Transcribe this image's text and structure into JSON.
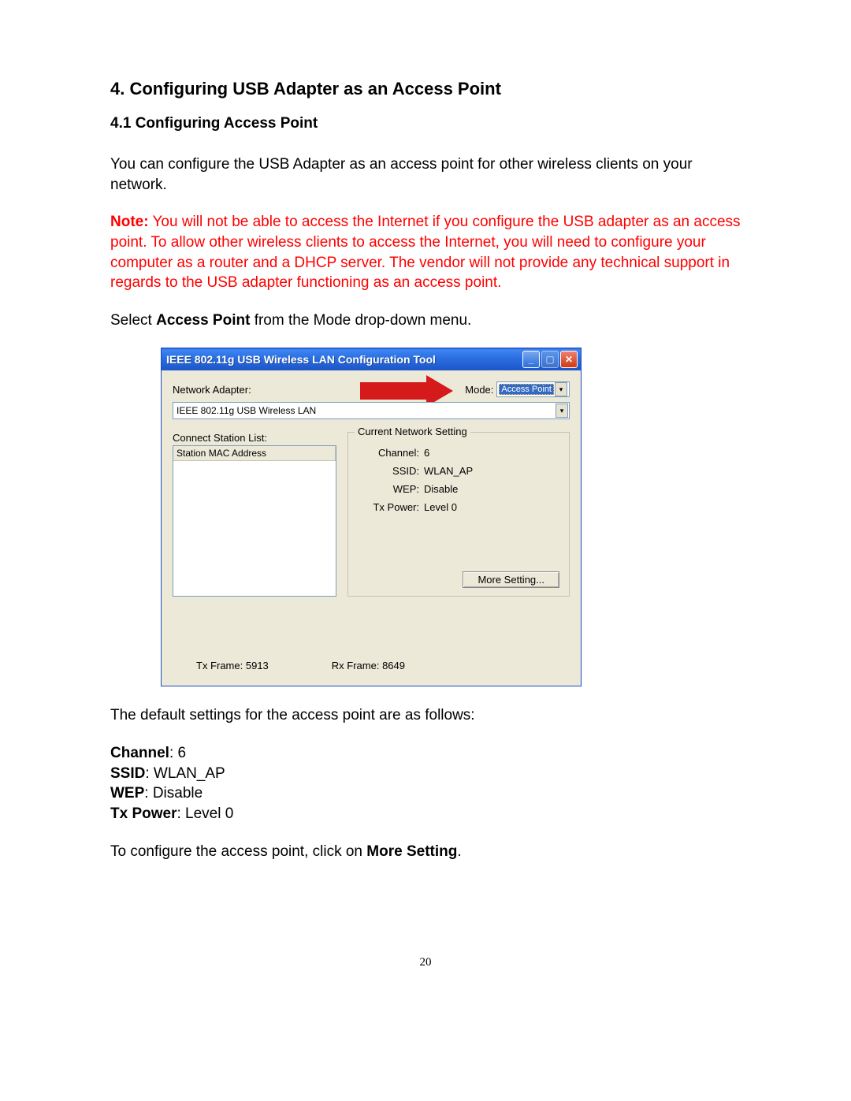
{
  "headings": {
    "h1": "4. Configuring USB Adapter as an Access Point",
    "h2": "4.1 Configuring Access Point"
  },
  "paragraphs": {
    "intro": "You can configure the USB Adapter as an access point for other wireless clients on your network.",
    "note_label": "Note:",
    "note_text": " You will not be able to access the Internet if you configure the USB adapter as an access point. To allow other wireless clients to access the Internet, you will need to configure your computer as a router and a DHCP server. The vendor will not provide any technical support in regards to the USB adapter functioning as an access point.",
    "select_pre": "Select ",
    "select_bold": "Access Point",
    "select_post": " from the Mode drop-down menu.",
    "defaults_intro": "The default settings for the access point are as follows:",
    "configure_pre": "To configure the access point, click on ",
    "configure_bold": "More Setting",
    "configure_post": "."
  },
  "screenshot": {
    "title": "IEEE 802.11g USB Wireless LAN Configuration Tool",
    "adapter_label": "Network Adapter:",
    "mode_label": "Mode:",
    "mode_value": "Access Point",
    "adapter_value": "IEEE 802.11g USB Wireless LAN",
    "list_label": "Connect Station List:",
    "list_header": "Station MAC Address",
    "fieldset_legend": "Current Network Setting",
    "channel_label": "Channel:",
    "channel_value": "6",
    "ssid_label": "SSID:",
    "ssid_value": "WLAN_AP",
    "wep_label": "WEP:",
    "wep_value": "Disable",
    "txpower_label": "Tx Power:",
    "txpower_value": "Level 0",
    "more_btn": "More Setting...",
    "txframe_label": "Tx Frame:",
    "txframe_value": "5913",
    "rxframe_label": "Rx Frame:",
    "rxframe_value": "8649"
  },
  "defaults": {
    "channel_k": "Channel",
    "channel_v": ": 6",
    "ssid_k": "SSID",
    "ssid_v": ": WLAN_AP",
    "wep_k": "WEP",
    "wep_v": ": Disable",
    "txp_k": "Tx Power",
    "txp_v": ": Level 0"
  },
  "page_number": "20"
}
